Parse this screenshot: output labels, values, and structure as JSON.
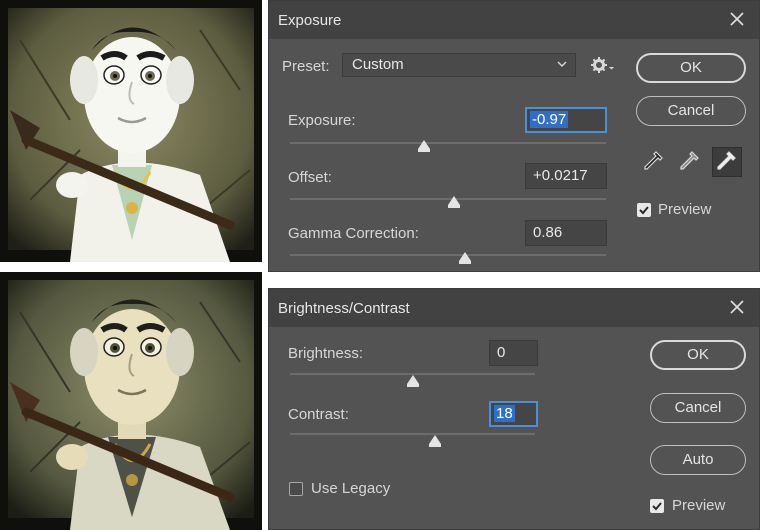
{
  "exposure_dialog": {
    "title": "Exposure",
    "preset": {
      "label": "Preset:",
      "value": "Custom"
    },
    "sliders": [
      {
        "label": "Exposure:",
        "value": "-0.97",
        "position": 0.425
      },
      {
        "label": "Offset:",
        "value": "+0.0217",
        "position": 0.52
      },
      {
        "label": "Gamma Correction:",
        "value": "0.86",
        "position": 0.555
      }
    ],
    "ok_label": "OK",
    "cancel_label": "Cancel",
    "preview_label": "Preview",
    "preview_checked": true,
    "active_eyedropper": "white-point"
  },
  "bc_dialog": {
    "title": "Brightness/Contrast",
    "sliders": [
      {
        "label": "Brightness:",
        "value": "0",
        "position": 0.5
      },
      {
        "label": "Contrast:",
        "value": "18",
        "position": 0.59
      }
    ],
    "ok_label": "OK",
    "cancel_label": "Cancel",
    "auto_label": "Auto",
    "legacy_label": "Use Legacy",
    "legacy_checked": false,
    "preview_label": "Preview",
    "preview_checked": true
  },
  "icons": {
    "close": "close-icon",
    "gear": "gear-icon",
    "dropdown": "chevron-down-icon",
    "eyedroppers": [
      "black-point-eyedropper-icon",
      "gray-point-eyedropper-icon",
      "white-point-eyedropper-icon"
    ],
    "checkmark": "checkmark-icon"
  },
  "colors": {
    "dialog_bg": "#535353",
    "titlebar_bg": "#424242",
    "selection": "#2e70c9",
    "focus_ring": "#4a90d6"
  }
}
